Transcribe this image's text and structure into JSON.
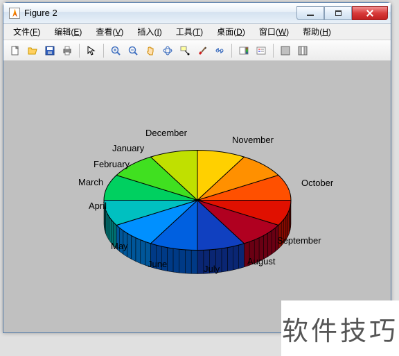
{
  "window": {
    "title": "Figure 2"
  },
  "menu": {
    "file": "文件",
    "file_u": "F",
    "edit": "编辑",
    "edit_u": "E",
    "view": "查看",
    "view_u": "V",
    "insert": "插入",
    "insert_u": "I",
    "tools": "工具",
    "tools_u": "T",
    "desktop": "桌面",
    "desktop_u": "D",
    "window": "窗口",
    "window_u": "W",
    "help": "帮助",
    "help_u": "H"
  },
  "labels": {
    "jan": "January",
    "feb": "February",
    "mar": "March",
    "apr": "April",
    "may": "May",
    "jun": "June",
    "jul": "July",
    "aug": "August",
    "sep": "September",
    "oct": "October",
    "nov": "November",
    "dec": "December"
  },
  "watermark": "软件技巧",
  "chart_data": {
    "type": "pie",
    "title": "",
    "style": "3d",
    "categories": [
      "January",
      "February",
      "March",
      "April",
      "May",
      "June",
      "July",
      "August",
      "September",
      "October",
      "November",
      "December"
    ],
    "values": [
      1,
      1,
      1,
      1,
      1,
      1,
      1,
      1,
      1,
      1,
      1,
      1
    ],
    "colors": [
      "#1040c0",
      "#0060e0",
      "#0090ff",
      "#00c0c0",
      "#00d060",
      "#40e020",
      "#c0e000",
      "#ffd000",
      "#ff9000",
      "#ff5000",
      "#e01000",
      "#b00020"
    ]
  }
}
